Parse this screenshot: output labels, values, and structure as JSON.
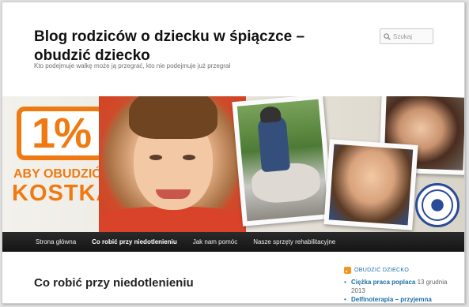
{
  "header": {
    "title": "Blog rodziców o dziecku w śpiączce – obudzić dziecko",
    "tagline": "Kto podejmuje walkę może ją przegrać, kto nie podejmuje już przegrał",
    "search_placeholder": "Szukaj"
  },
  "banner": {
    "logo_text": "1%",
    "slogan_line1": "ABY OBUDZIĆ",
    "slogan_line2": "KOSTKA",
    "brand_color": "#f07a12",
    "seal_color": "#2a4b99"
  },
  "nav": {
    "items": [
      {
        "label": "Strona główna",
        "active": false
      },
      {
        "label": "Co robić przy niedotlenieniu",
        "active": true
      },
      {
        "label": "Jak nam pomóc",
        "active": false
      },
      {
        "label": "Nasze sprzęty rehabilitacyjne",
        "active": false
      }
    ]
  },
  "content": {
    "title": "Co robić przy niedotlenieniu"
  },
  "sidebar": {
    "widget_title": "OBUDZIĆ DZIECKO",
    "posts": [
      {
        "title": "Ciężka praca poplaca",
        "date": "13 grudnia 2013"
      },
      {
        "title": "Delfinoterapia – przyjemna",
        "date": ""
      }
    ]
  },
  "icons": {
    "search": "search-icon",
    "rss": "rss-icon"
  },
  "colors": {
    "link": "#1b6ea8",
    "nav_bg": "#1e1e1e"
  }
}
